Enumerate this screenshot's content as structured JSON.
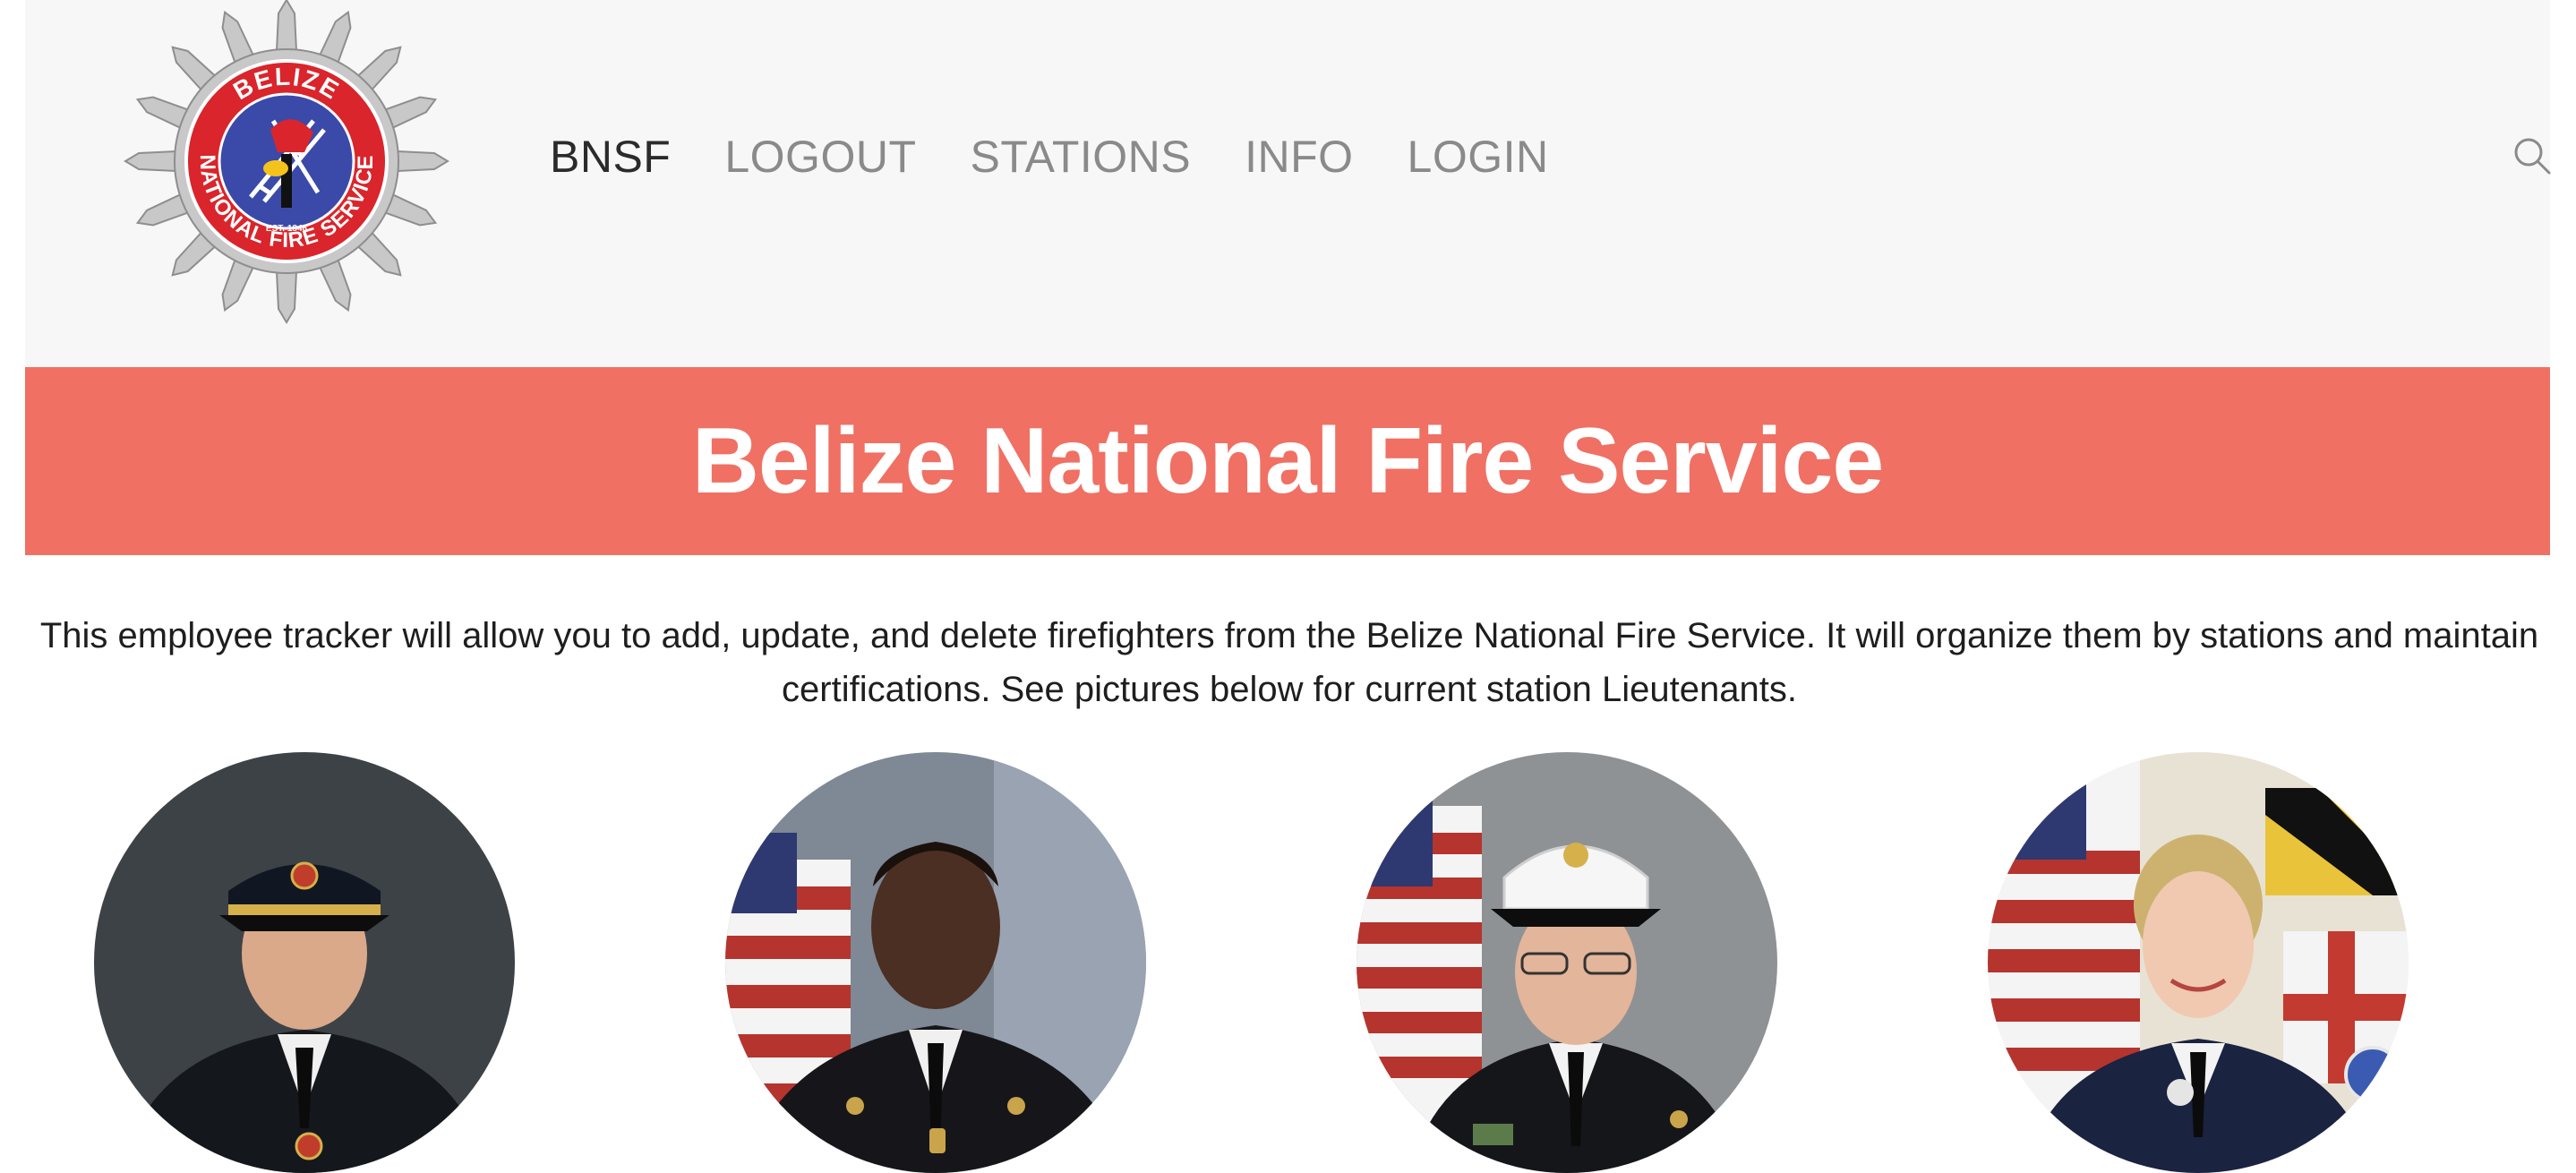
{
  "navbar": {
    "logo": {
      "ring_text_top": "BELIZE",
      "ring_text_bottom": "NATIONAL FIRE SERVICE",
      "established": "EST. 1846",
      "colors": {
        "ring": "#d9252b",
        "center": "#3b4aa8",
        "star": "#c8c8c8"
      }
    },
    "links": [
      {
        "label": "BNSF",
        "is_brand": true
      },
      {
        "label": "LOGOUT"
      },
      {
        "label": "STATIONS"
      },
      {
        "label": "INFO"
      },
      {
        "label": "LOGIN"
      }
    ],
    "search_icon": "search-icon"
  },
  "banner": {
    "title": "Belize National Fire Service",
    "color": "#f07064"
  },
  "description": "This employee tracker will allow you to add, update, and delete firefighters from the Belize National Fire Service. It will organize them by stations and maintain certifications. See pictures below for current station Lieutenants.",
  "lieutenants": [
    {
      "photo": "lieutenant-1-photo"
    },
    {
      "photo": "lieutenant-2-photo"
    },
    {
      "photo": "lieutenant-3-photo"
    },
    {
      "photo": "lieutenant-4-photo"
    }
  ]
}
